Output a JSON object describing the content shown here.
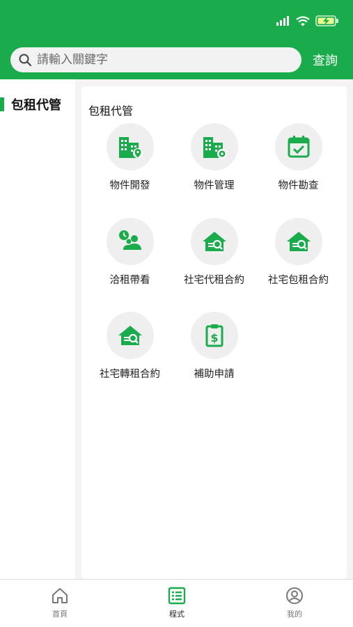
{
  "colors": {
    "brand": "#1aac4c",
    "inactive": "#777777"
  },
  "status_bar": {
    "signal_icon": "signal-icon",
    "wifi_icon": "wifi-icon",
    "battery_icon": "battery-charging-icon"
  },
  "search": {
    "placeholder": "請輸入關鍵字",
    "button_label": "查詢"
  },
  "sidebar": {
    "items": [
      {
        "label": "包租代管",
        "active": true
      }
    ]
  },
  "panel": {
    "title": "包租代管",
    "items": [
      {
        "label": "物件開發",
        "icon": "building-location-icon"
      },
      {
        "label": "物件管理",
        "icon": "building-settings-icon"
      },
      {
        "label": "物件勘查",
        "icon": "calendar-check-icon"
      },
      {
        "label": "洽租帶看",
        "icon": "people-clock-icon"
      },
      {
        "label": "社宅代租合約",
        "icon": "house-search-icon"
      },
      {
        "label": "社宅包租合約",
        "icon": "house-search-icon"
      },
      {
        "label": "社宅轉租合約",
        "icon": "house-search-icon"
      },
      {
        "label": "補助申請",
        "icon": "clipboard-dollar-icon"
      }
    ]
  },
  "tabbar": {
    "tabs": [
      {
        "label": "首頁",
        "icon": "home-icon",
        "active": false
      },
      {
        "label": "程式",
        "icon": "list-icon",
        "active": true
      },
      {
        "label": "我的",
        "icon": "user-circle-icon",
        "active": false
      }
    ]
  }
}
